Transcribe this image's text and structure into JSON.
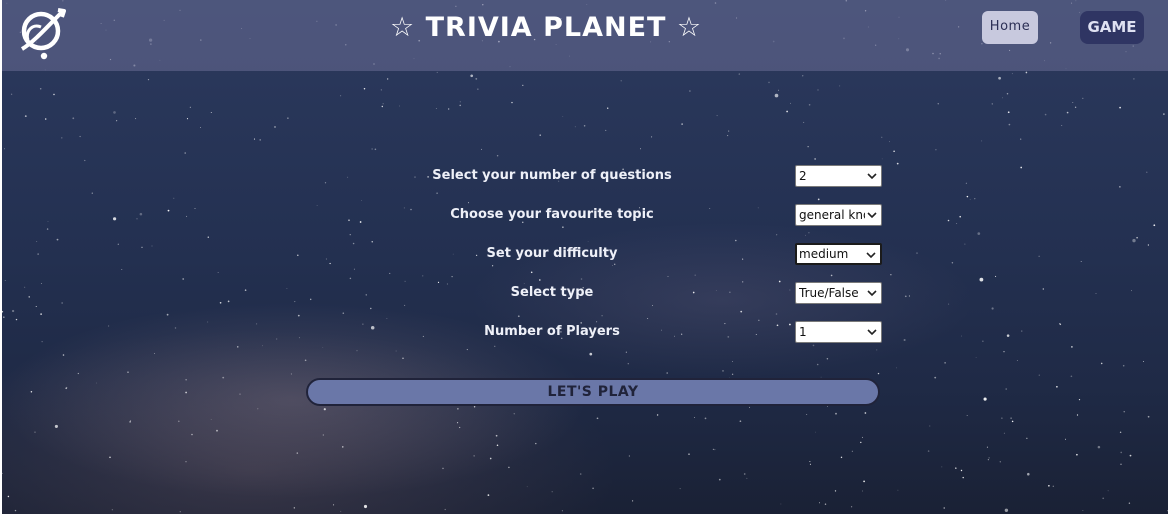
{
  "header": {
    "title": "☆ TRIVIA PLANET ☆",
    "nav": {
      "home_label": "Home",
      "game_label": "GAME"
    },
    "logo_icon": "planet-logo-icon"
  },
  "form": {
    "questions": {
      "label": "Select your number of questions",
      "value": "2"
    },
    "topic": {
      "label": "Choose your favourite topic",
      "value": "general knowledge"
    },
    "difficulty": {
      "label": "Set your difficulty",
      "value": "medium"
    },
    "type": {
      "label": "Select type",
      "value": "True/False"
    },
    "players": {
      "label": "Number of Players",
      "value": "1"
    },
    "play_label": "LET'S PLAY"
  },
  "colors": {
    "header_bg": "#696e96",
    "home_button": "#c8c9de",
    "game_button": "#2f3563",
    "play_button": "#6a77a8"
  }
}
